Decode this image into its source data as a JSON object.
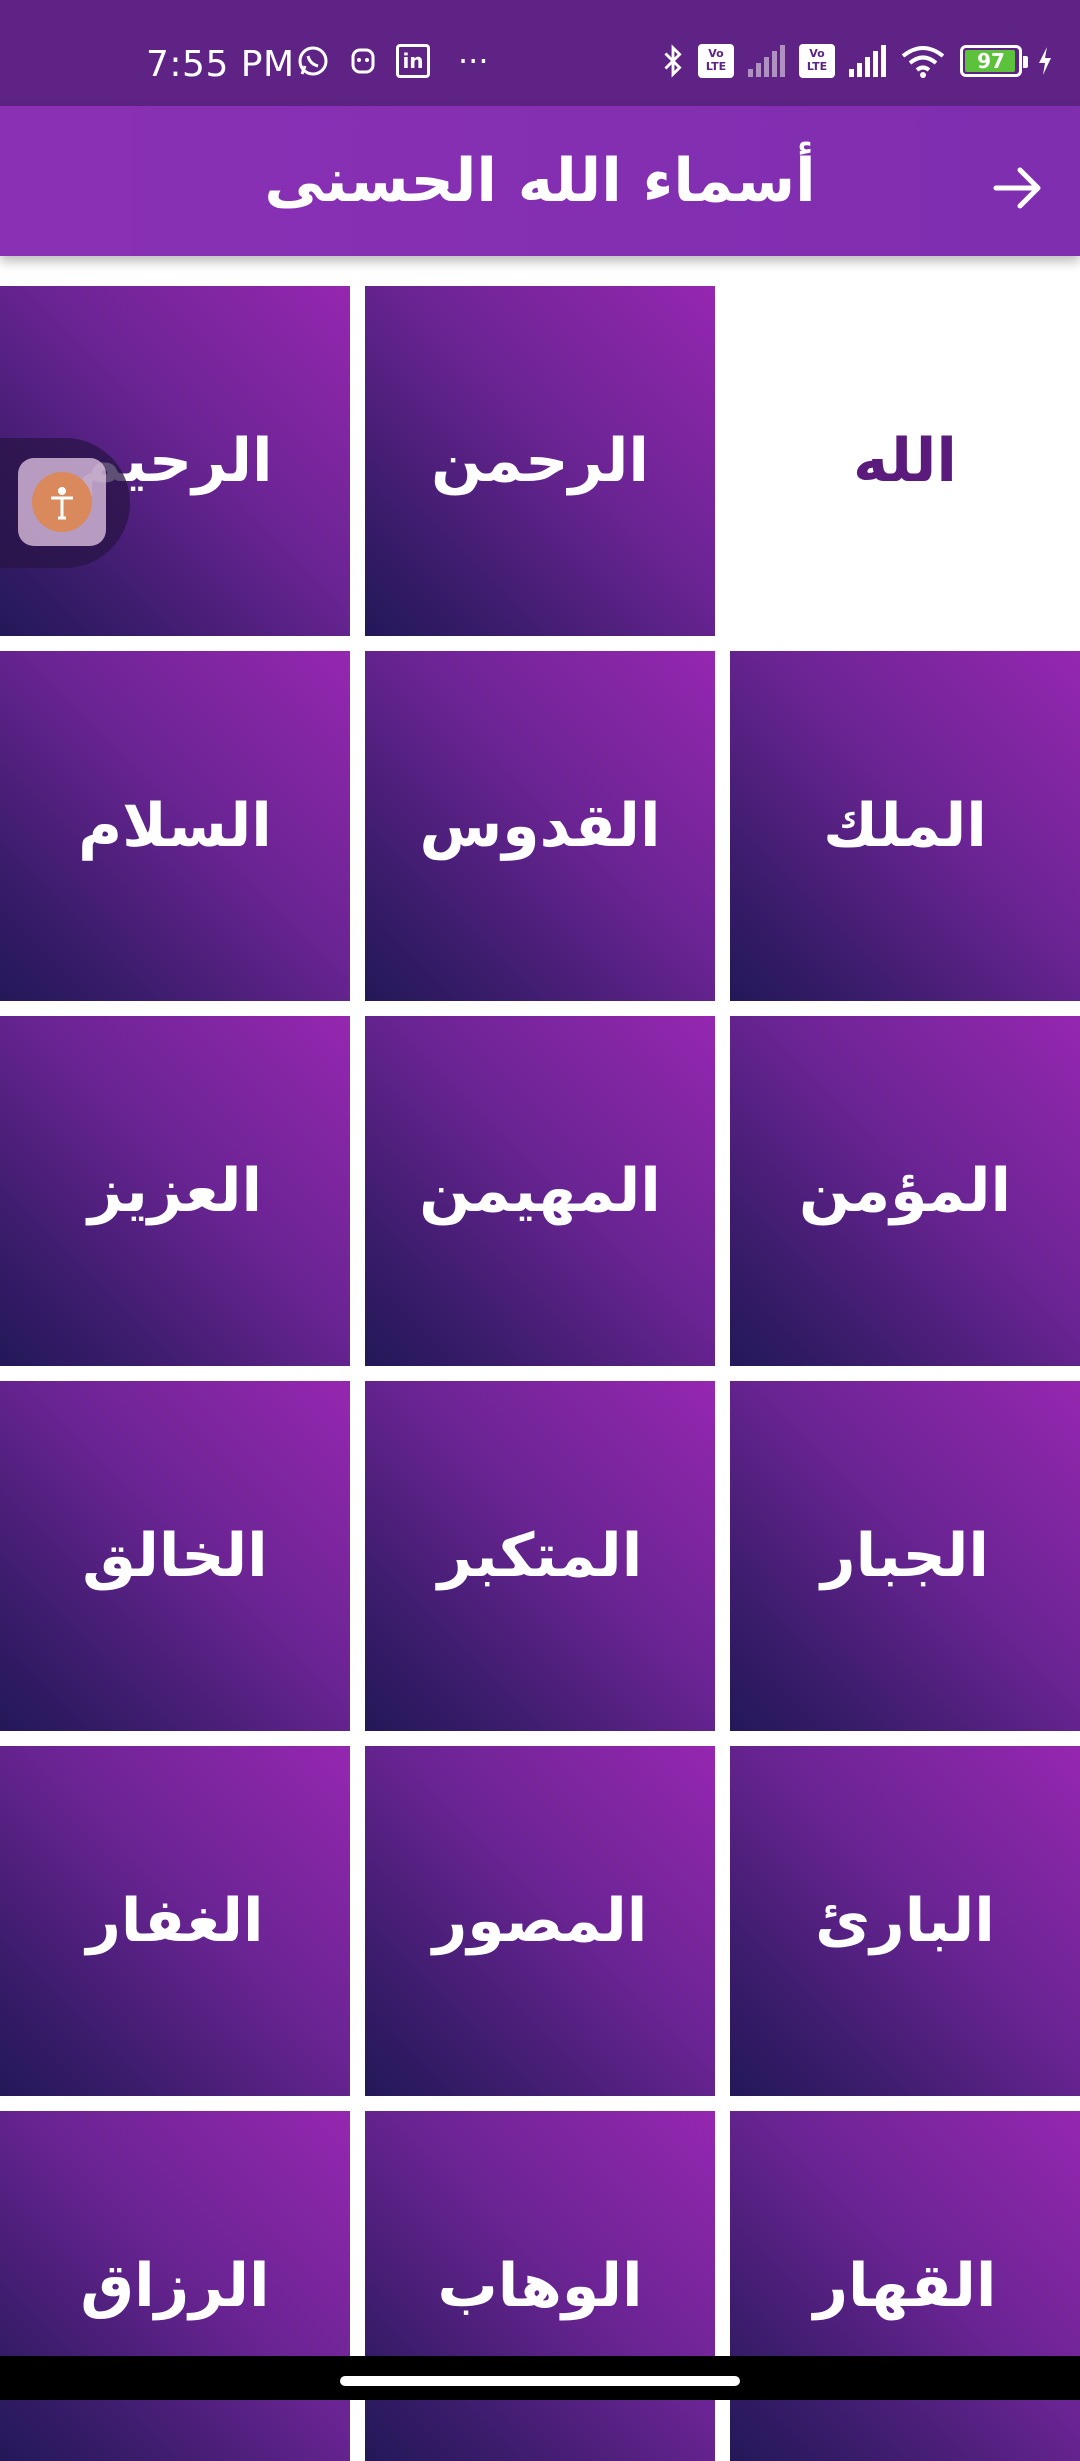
{
  "status_bar": {
    "time": "7:55 PM",
    "left_icons": [
      "whatsapp-icon",
      "notification-icon",
      "linkedin-icon",
      "more-dots-icon"
    ],
    "linkedin_label": "in",
    "more_label": "···",
    "volte_label": "Vo\nLTE",
    "battery_percent": "97",
    "battery_level": 0.97,
    "colors": {
      "background": "#5f2385",
      "battery_fill": "#5cc13b"
    }
  },
  "app_bar": {
    "title": "أسماء الله الحسنى",
    "back_icon": "arrow-right-icon",
    "background": "#8a30b5"
  },
  "names_grid": {
    "selected_index": 0,
    "items": [
      "الله",
      "الرحمن",
      "الرحيم",
      "الملك",
      "القدوس",
      "السلام",
      "المؤمن",
      "المهيمن",
      "العزيز",
      "الجبار",
      "المتكبر",
      "الخالق",
      "البارئ",
      "المصور",
      "الغفار",
      "القهار",
      "الوهاب",
      "الرزاق"
    ],
    "colors": {
      "gradient_top": "#9527b0",
      "gradient_bottom": "#231858",
      "selected_text": "#5a1b7d"
    }
  },
  "floating_button": {
    "icon": "accessibility-icon"
  }
}
